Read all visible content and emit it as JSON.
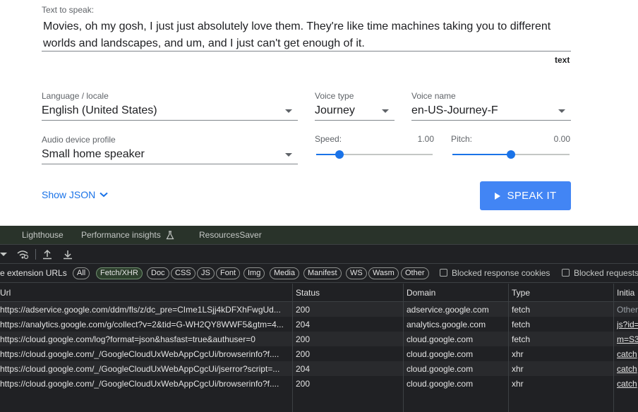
{
  "tts": {
    "text_label": "Text to speak:",
    "text_value": "Movies, oh my gosh, I just just absolutely love them. They're like time machines taking you to different worlds and landscapes, and um, and I just can't get enough of it.",
    "text_type_badge": "text",
    "language_label": "Language / locale",
    "language_value": "English (United States)",
    "voice_type_label": "Voice type",
    "voice_type_value": "Journey",
    "voice_name_label": "Voice name",
    "voice_name_value": "en-US-Journey-F",
    "audio_profile_label": "Audio device profile",
    "audio_profile_value": "Small home speaker",
    "speed_label": "Speed:",
    "speed_value": "1.00",
    "speed_level": 0.2,
    "pitch_label": "Pitch:",
    "pitch_value": "0.00",
    "pitch_level": 0.5,
    "show_json_label": "Show JSON",
    "speak_button_label": "SPEAK IT",
    "accent_color": "#1a73e8",
    "button_color": "#4285f4"
  },
  "devtools": {
    "tabs": [
      "Lighthouse",
      "Performance insights",
      "ResourcesSaver"
    ],
    "filter": {
      "hide_extension_label": "e extension URLs",
      "chips": [
        "All",
        "Fetch/XHR",
        "Doc",
        "CSS",
        "JS",
        "Font",
        "Img",
        "Media",
        "Manifest",
        "WS",
        "Wasm",
        "Other"
      ],
      "active_chip": "Fetch/XHR",
      "blocked_cookies_label": "Blocked response cookies",
      "blocked_requests_label": "Blocked requests"
    },
    "columns": [
      "Url",
      "Status",
      "Domain",
      "Type",
      "Initia"
    ],
    "rows": [
      {
        "url": "https://adservice.google.com/ddm/fls/z/dc_pre=CIme1LSjj4kDFXhFwgUd...",
        "status": "200",
        "domain": "adservice.google.com",
        "type": "fetch",
        "initiator": "Other"
      },
      {
        "url": "https://analytics.google.com/g/collect?v=2&tid=G-WH2QY8WWF5&gtm=4...",
        "status": "204",
        "domain": "analytics.google.com",
        "type": "fetch",
        "initiator": "js?id="
      },
      {
        "url": "https://cloud.google.com/log?format=json&hasfast=true&authuser=0",
        "status": "200",
        "domain": "cloud.google.com",
        "type": "fetch",
        "initiator": "m=S3"
      },
      {
        "url": "https://cloud.google.com/_/GoogleCloudUxWebAppCgcUi/browserinfo?f....",
        "status": "200",
        "domain": "cloud.google.com",
        "type": "xhr",
        "initiator": "catch"
      },
      {
        "url": "https://cloud.google.com/_/GoogleCloudUxWebAppCgcUi/jserror?script=...",
        "status": "204",
        "domain": "cloud.google.com",
        "type": "xhr",
        "initiator": "catch"
      },
      {
        "url": "https://cloud.google.com/_/GoogleCloudUxWebAppCgcUi/browserinfo?f....",
        "status": "200",
        "domain": "cloud.google.com",
        "type": "xhr",
        "initiator": "catch"
      }
    ]
  }
}
